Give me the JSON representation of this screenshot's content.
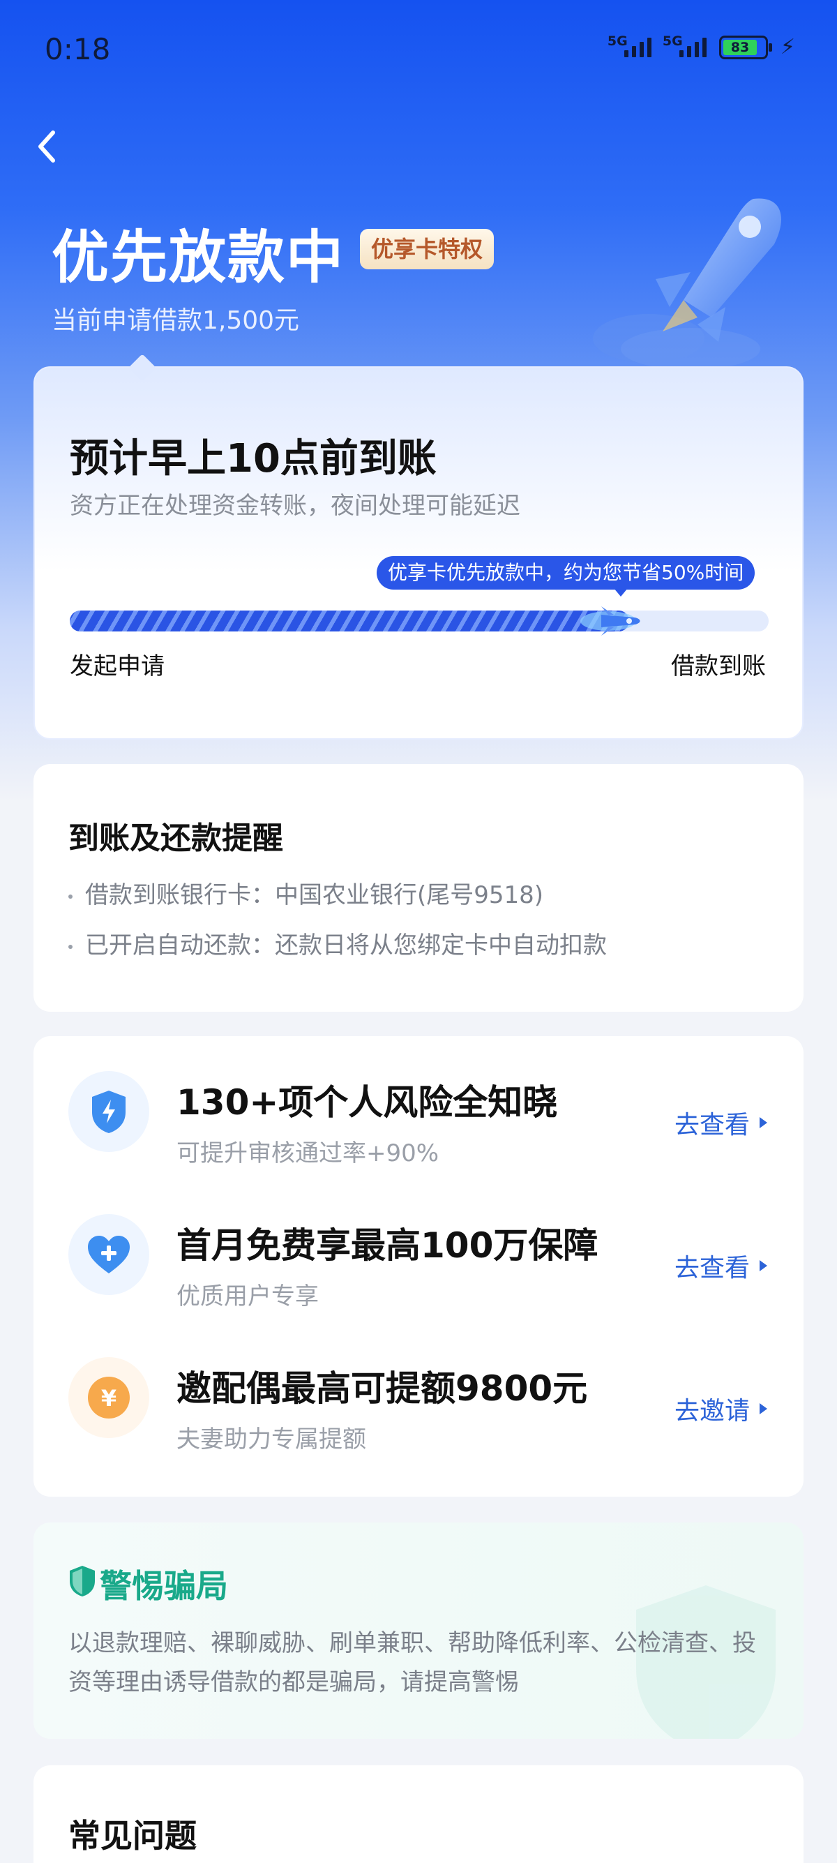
{
  "status_bar": {
    "time": "0:18",
    "signal1": "5G",
    "signal2": "5G",
    "battery": "83"
  },
  "header": {
    "title": "优先放款中",
    "badge": "优享卡特权",
    "subtitle": "当前申请借款1,500元"
  },
  "progress_card": {
    "title": "预计早上10点前到账",
    "subtitle": "资方正在处理资金转账，夜间处理可能延迟",
    "tip": "优享卡优先放款中，约为您节省50%时间",
    "progress_fraction": 0.8,
    "start_label": "发起申请",
    "end_label": "借款到账"
  },
  "reminder": {
    "title": "到账及还款提醒",
    "items": [
      "借款到账银行卡：中国农业银行(尾号9518)",
      "已开启自动还款：还款日将从您绑定卡中自动扣款"
    ]
  },
  "services": [
    {
      "title": "130+项个人风险全知晓",
      "subtitle": "可提升审核通过率+90%",
      "link": "去查看",
      "icon": "shield-bolt-icon",
      "icon_color": "#3d8ef0"
    },
    {
      "title": "首月免费享最高100万保障",
      "subtitle": "优质用户专享",
      "link": "去查看",
      "icon": "heart-plus-icon",
      "icon_color": "#3d8ef0"
    },
    {
      "title": "邀配偶最高可提额9800元",
      "subtitle": "夫妻助力专属提额",
      "link": "去邀请",
      "icon": "yuan-coin-icon",
      "icon_color": "#f7a94c"
    }
  ],
  "warning": {
    "title": "警惕骗局",
    "text": "以退款理赔、裸聊威胁、刷单兼职、帮助降低利率、公检清查、投资等理由诱导借款的都是骗局，请提高警惕",
    "color": "#19a98a"
  },
  "faq": {
    "title": "常见问题"
  },
  "colors": {
    "brand_blue": "#1552f0",
    "link_blue": "#2c63d8"
  }
}
